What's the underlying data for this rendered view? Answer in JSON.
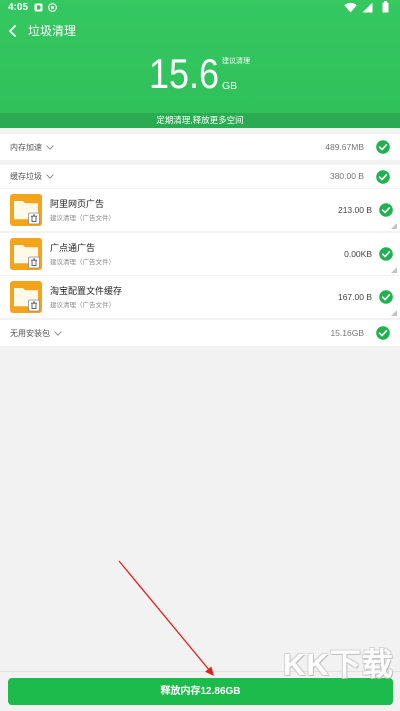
{
  "colors": {
    "brand_green": "#35c760",
    "band_green": "#2aab52",
    "check_green": "#1fb24e",
    "button_green": "#1dba4c",
    "folder_orange": "#f2a51a",
    "page_bg": "#f2f2f2",
    "annotation_red": "#e2231a"
  },
  "status_bar": {
    "time": "4:05",
    "left_icons": [
      "app-notification-icon",
      "at-sign-icon"
    ],
    "right_icons": [
      "wifi-icon",
      "cell-signal-icon",
      "battery-icon"
    ]
  },
  "header": {
    "back_icon": "chevron-left-icon",
    "title": "垃圾清理"
  },
  "summary": {
    "value": "15.6",
    "unit": "GB",
    "hint": "建议清理",
    "banner": "定期清理,释放更多空间"
  },
  "list": {
    "memory": {
      "label": "内存加速",
      "size": "489.67MB",
      "checked": true
    },
    "cache": {
      "label": "缓存垃圾",
      "size": "380.00 B",
      "checked": true,
      "items": [
        {
          "icon": "folder-trash-icon",
          "title": "阿里网页广告",
          "subtitle": "建议清理（广告文件）",
          "size": "213.00 B",
          "checked": true
        },
        {
          "icon": "folder-trash-icon",
          "title": "广点通广告",
          "subtitle": "建议清理（广告文件）",
          "size": "0.00KB",
          "checked": true
        },
        {
          "icon": "folder-trash-icon",
          "title": "淘宝配置文件缓存",
          "subtitle": "建议清理（广告文件）",
          "size": "167.00 B",
          "checked": true
        }
      ]
    },
    "apk": {
      "label": "无用安装包",
      "size": "15.16GB",
      "checked": true
    }
  },
  "footer": {
    "button_label": "释放内存12.86GB"
  },
  "watermark": {
    "text": "KK下载"
  }
}
